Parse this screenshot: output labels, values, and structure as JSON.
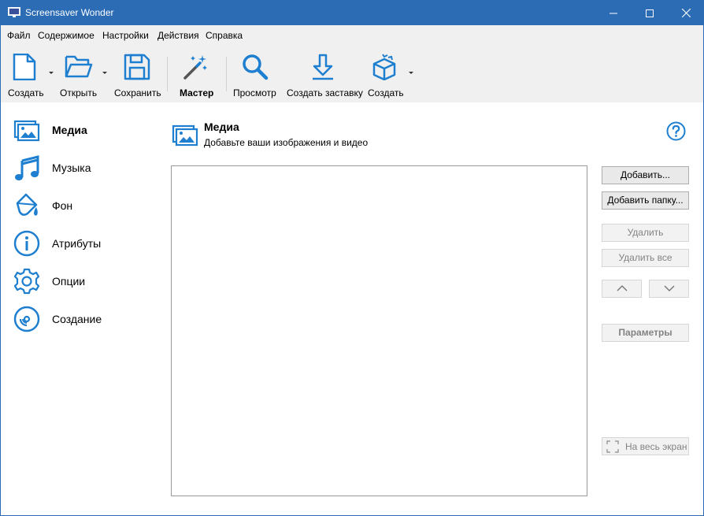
{
  "window": {
    "title": "Screensaver Wonder",
    "accent_color": "#2b6cb5",
    "icon_color": "#1e7fd0"
  },
  "menu": [
    "Файл",
    "Содержимое",
    "Настройки",
    "Действия",
    "Справка"
  ],
  "toolbar": {
    "create_label": "Создать",
    "open_label": "Открыть",
    "save_label": "Сохранить",
    "wizard_label": "Мастер",
    "preview_label": "Просмотр",
    "make_screensaver_label": "Создать заставку",
    "build_label": "Создать"
  },
  "sidebar": {
    "items": [
      {
        "label": "Медиа",
        "icon": "media-icon",
        "active": true
      },
      {
        "label": "Музыка",
        "icon": "music-note-icon",
        "active": false
      },
      {
        "label": "Фон",
        "icon": "paint-bucket-icon",
        "active": false
      },
      {
        "label": "Атрибуты",
        "icon": "info-icon",
        "active": false
      },
      {
        "label": "Опции",
        "icon": "gear-icon",
        "active": false
      },
      {
        "label": "Создание",
        "icon": "disc-icon",
        "active": false
      }
    ]
  },
  "content": {
    "title": "Медиа",
    "subtitle": "Добавьте ваши изображения и видео"
  },
  "buttons": {
    "add": "Добавить...",
    "add_folder": "Добавить папку...",
    "delete": "Удалить",
    "delete_all": "Удалить все",
    "parameters": "Параметры",
    "fullscreen": "На весь экран"
  }
}
